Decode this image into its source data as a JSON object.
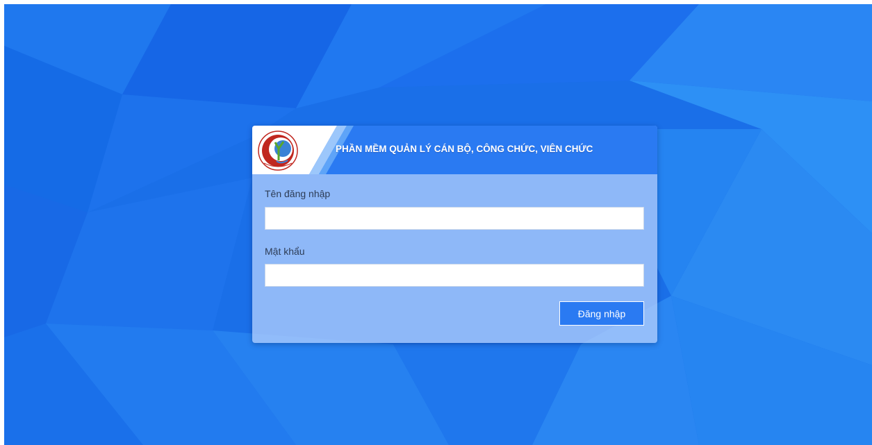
{
  "header": {
    "title": "PHẦN MỀM QUẢN LÝ CÁN BỘ, CÔNG CHỨC, VIÊN CHỨC",
    "logo_icon": "organization-logo-icon"
  },
  "form": {
    "username_label": "Tên đăng nhập",
    "username_value": "",
    "password_label": "Mật khẩu",
    "password_value": "",
    "submit_label": "Đăng nhập"
  },
  "colors": {
    "background": "#1a6fe8",
    "header_band": "#2a7af2",
    "button": "#2a7af2",
    "logo_red": "#c0271f",
    "logo_green": "#5aa62e"
  }
}
